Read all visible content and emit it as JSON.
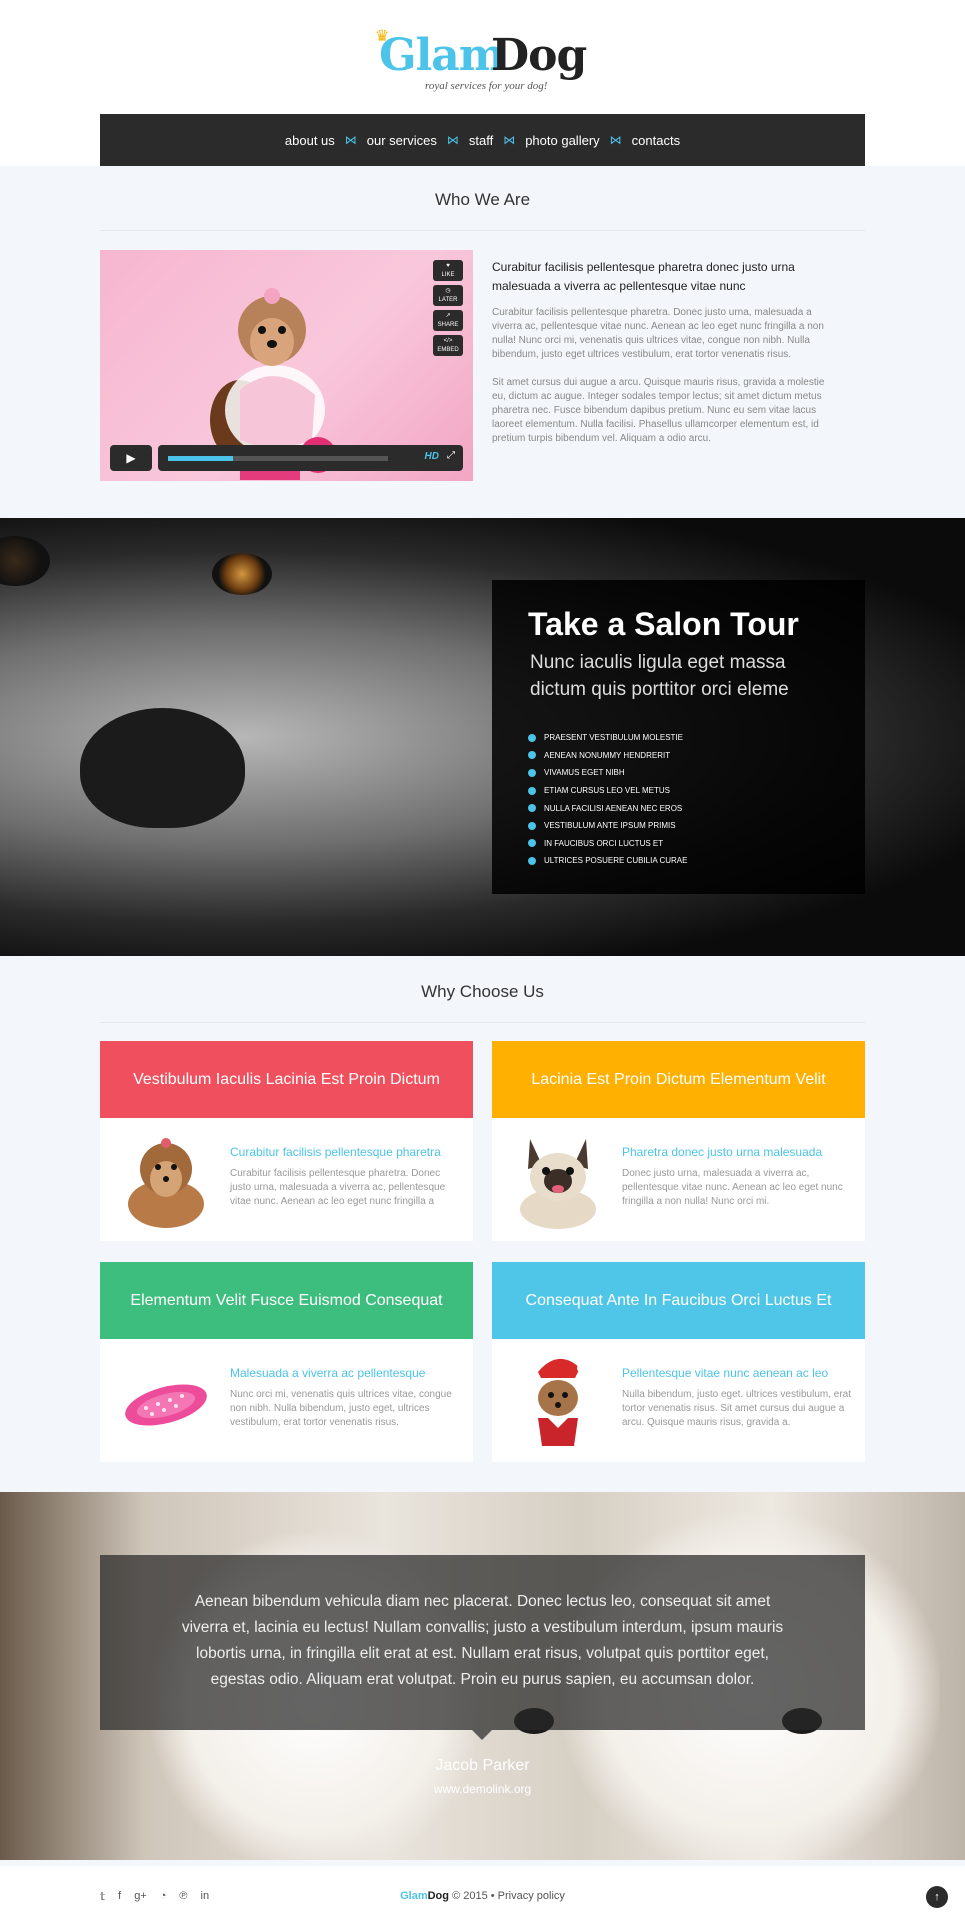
{
  "brand": {
    "glam": "Glam",
    "dog": "Dog",
    "tagline": "royal services for your dog!"
  },
  "nav": [
    "about us",
    "our services",
    "staff",
    "photo gallery",
    "contacts"
  ],
  "who": {
    "title": "Who We Are",
    "video_buttons": [
      "LIKE",
      "LATER",
      "SHARE",
      "EMBED"
    ],
    "video_hd": "HD",
    "heading": "Curabitur facilisis pellentesque pharetra donec justo urna malesuada a viverra ac pellentesque vitae nunc",
    "p1": "Curabitur facilisis pellentesque pharetra. Donec justo urna, malesuada a viverra ac, pellentesque vitae nunc. Aenean ac leo eget nunc fringilla a non nulla! Nunc orci mi, venenatis quis ultrices vitae, congue non nibh. Nulla bibendum, justo eget ultrices vestibulum, erat tortor venenatis risus.",
    "p2": "Sit amet cursus dui augue a arcu. Quisque mauris risus, gravida a molestie eu, dictum ac augue. Integer sodales tempor lectus; sit amet dictum metus pharetra nec. Fusce bibendum dapibus pretium. Nunc eu sem vitae lacus laoreet elementum. Nulla facilisi. Phasellus ullamcorper elementum est, id pretium turpis bibendum vel. Aliquam a odio arcu."
  },
  "salon": {
    "title": "Take a Salon Tour",
    "subtitle": "Nunc iaculis ligula eget massa dictum quis porttitor orci eleme",
    "items": [
      "PRAESENT VESTIBULUM MOLESTIE",
      "AENEAN NONUMMY HENDRERIT",
      "VIVAMUS EGET NIBH",
      "ETIAM CURSUS LEO VEL METUS",
      "NULLA FACILISI AENEAN NEC EROS",
      "VESTIBULUM ANTE IPSUM PRIMIS",
      "IN FAUCIBUS ORCI LUCTUS ET",
      "ULTRICES POSUERE CUBILIA CURAE"
    ]
  },
  "why": {
    "title": "Why Choose Us",
    "cards": [
      {
        "head": "Vestibulum Iaculis Lacinia Est Proin Dictum",
        "color": "#f0505d",
        "title": "Curabitur facilisis pellentesque pharetra",
        "text": "Curabitur facilisis pellentesque pharetra. Donec justo urna, malesuada a viverra ac, pellentesque vitae nunc. Aenean ac leo eget nunc fringilla a"
      },
      {
        "head": "Lacinia Est Proin Dictum Elementum Velit",
        "color": "#ffb000",
        "title": "Pharetra donec justo urna malesuada",
        "text": "Donec justo urna, malesuada a viverra ac, pellentesque vitae nunc. Aenean ac leo eget nunc fringilla a non nulla! Nunc orci mi."
      },
      {
        "head": "Elementum Velit Fusce Euismod Consequat",
        "color": "#3dbe7f",
        "title": "Malesuada a viverra ac pellentesque",
        "text": "Nunc orci mi, venenatis quis ultrices vitae, congue non nibh. Nulla bibendum, justo eget, ultrices vestibulum, erat tortor venenatis risus."
      },
      {
        "head": "Consequat Ante In Faucibus Orci Luctus Et",
        "color": "#4fc6e8",
        "title": "Pellentesque vitae nunc aenean ac leo",
        "text": "Nulla bibendum, justo eget. ultrices vestibulum, erat tortor venenatis risus. Sit amet cursus dui augue a arcu. Quisque mauris risus, gravida a."
      }
    ]
  },
  "testimonial": {
    "quote": "Aenean bibendum vehicula diam nec placerat. Donec lectus leo, consequat sit amet viverra et, lacinia eu lectus! Nullam convallis; justo a vestibulum interdum, ipsum mauris lobortis urna, in fringilla elit erat at est. Nullam erat risus, volutpat quis porttitor eget, egestas odio. Aliquam erat volutpat. Proin eu purus sapien, eu accumsan dolor.",
    "author": "Jacob Parker",
    "site": "www.demolink.org"
  },
  "footer": {
    "social": [
      "twitter-icon",
      "facebook-icon",
      "google-plus-icon",
      "rss-icon",
      "pinterest-icon",
      "linkedin-icon"
    ],
    "brand_glam": "Glam",
    "brand_dog": "Dog",
    "copy": " © 2015 • Privacy policy"
  },
  "colors": {
    "accent": "#4cc3e8",
    "dark": "#2b2b2b"
  }
}
